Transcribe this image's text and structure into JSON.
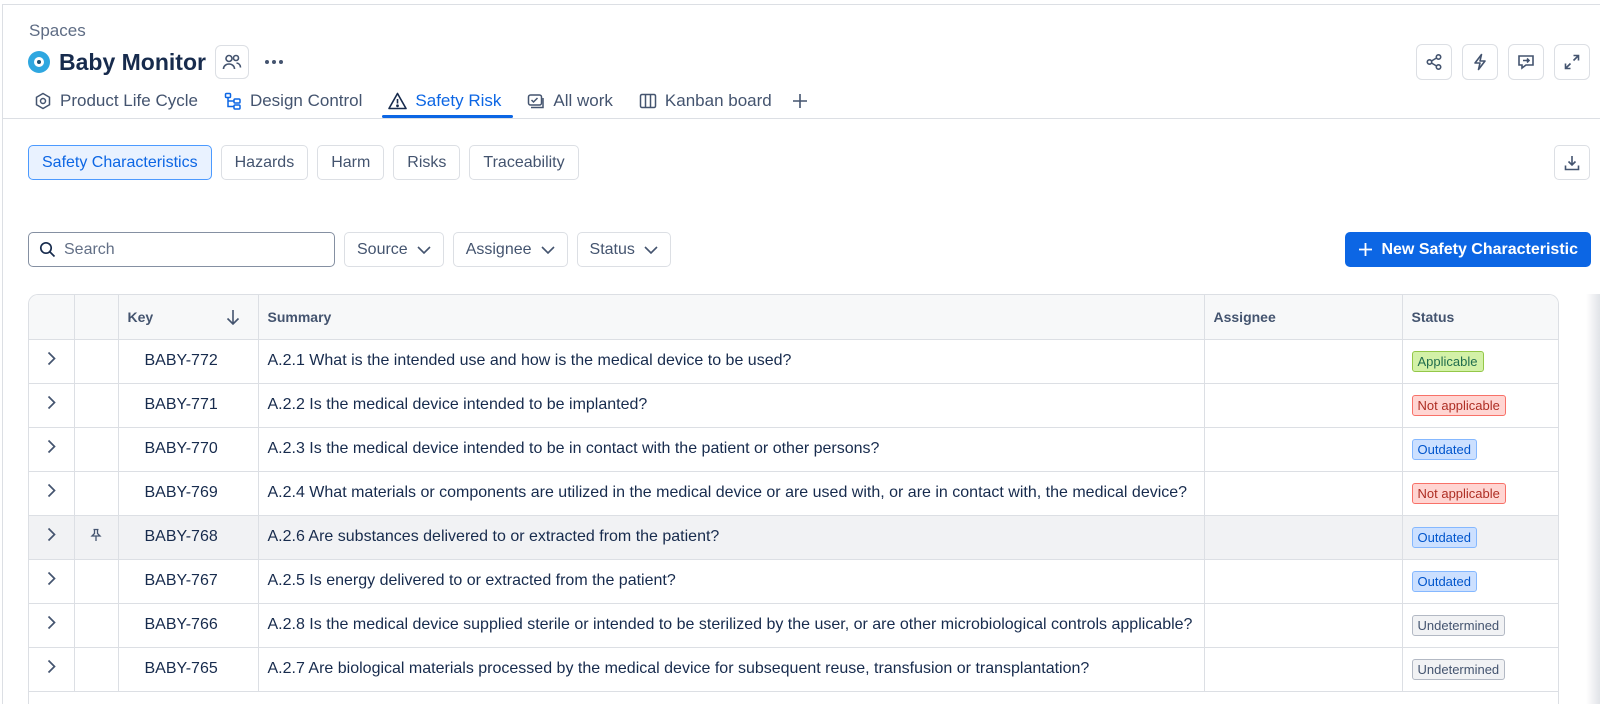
{
  "breadcrumb": "Spaces",
  "space": {
    "title": "Baby Monitor"
  },
  "tabs": [
    {
      "label": "Product Life Cycle",
      "icon": "hexagon-settings-icon",
      "active": false
    },
    {
      "label": "Design Control",
      "icon": "hierarchy-icon",
      "active": false
    },
    {
      "label": "Safety Risk",
      "icon": "warning-triangle-icon",
      "active": true
    },
    {
      "label": "All work",
      "icon": "list-check-icon",
      "active": false
    },
    {
      "label": "Kanban board",
      "icon": "board-columns-icon",
      "active": false
    }
  ],
  "subtabs": [
    {
      "label": "Safety Characteristics",
      "active": true
    },
    {
      "label": "Hazards",
      "active": false
    },
    {
      "label": "Harm",
      "active": false
    },
    {
      "label": "Risks",
      "active": false
    },
    {
      "label": "Traceability",
      "active": false
    }
  ],
  "toolbar": {
    "search_placeholder": "Search",
    "filters": [
      "Source",
      "Assignee",
      "Status"
    ],
    "new_button": "New Safety Characteristic"
  },
  "table": {
    "columns": {
      "key": "Key",
      "summary": "Summary",
      "assignee": "Assignee",
      "status": "Status"
    },
    "rows": [
      {
        "key": "BABY-772",
        "summary": "A.2.1 What is the intended use and how is the medical device to be used?",
        "assignee": "",
        "status": "Applicable",
        "status_type": "green",
        "pinned": false
      },
      {
        "key": "BABY-771",
        "summary": "A.2.2 Is the medical device intended to be implanted?",
        "assignee": "",
        "status": "Not applicable",
        "status_type": "red",
        "pinned": false
      },
      {
        "key": "BABY-770",
        "summary": "A.2.3 Is the medical device intended to be in contact with the patient or other persons?",
        "assignee": "",
        "status": "Outdated",
        "status_type": "blue",
        "pinned": false
      },
      {
        "key": "BABY-769",
        "summary": "A.2.4 What materials or components are utilized in the medical device or are used with, or are in contact with, the medical device?",
        "assignee": "",
        "status": "Not applicable",
        "status_type": "red",
        "pinned": false
      },
      {
        "key": "BABY-768",
        "summary": "A.2.6 Are substances delivered to or extracted from the patient?",
        "assignee": "",
        "status": "Outdated",
        "status_type": "blue",
        "pinned": true
      },
      {
        "key": "BABY-767",
        "summary": "A.2.5 Is energy delivered to or extracted from the patient?",
        "assignee": "",
        "status": "Outdated",
        "status_type": "blue",
        "pinned": false
      },
      {
        "key": "BABY-766",
        "summary": "A.2.8 Is the medical device supplied sterile or intended to be sterilized by the user, or are other microbiological controls applicable?",
        "assignee": "",
        "status": "Undetermined",
        "status_type": "gray",
        "pinned": false
      },
      {
        "key": "BABY-765",
        "summary": "A.2.7 Are biological materials processed by the medical device for subsequent reuse, transfusion or transplantation?",
        "assignee": "",
        "status": "Undetermined",
        "status_type": "gray",
        "pinned": false
      }
    ]
  },
  "colors": {
    "accent": "#0c66e4",
    "border": "#dcdfe4",
    "text": "#172b4d"
  }
}
